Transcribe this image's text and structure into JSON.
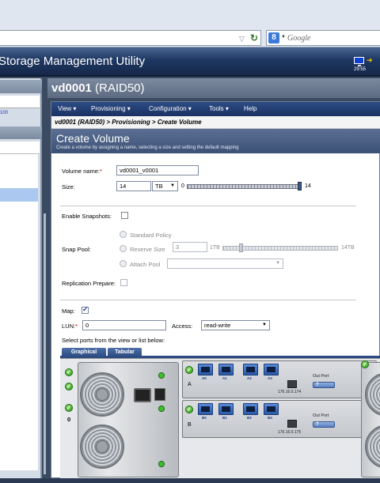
{
  "browser": {
    "search_placeholder": "Google",
    "search_engine_letter": "8"
  },
  "app": {
    "title": "Storage Management Utility",
    "clock": "29:55"
  },
  "left_panel": {
    "link_fragment": "100"
  },
  "header": {
    "volume_name": "vd0001",
    "raid_level": "(RAID50)"
  },
  "menu": [
    {
      "label": "View ▾"
    },
    {
      "label": "Provisioning ▾"
    },
    {
      "label": "Configuration ▾"
    },
    {
      "label": "Tools ▾"
    },
    {
      "label": "Help"
    }
  ],
  "breadcrumb": "vd0001 (RAID50) > Provisioning > Create Volume",
  "page": {
    "title": "Create Volume",
    "subtitle": "Create a volume by assigning a name, selecting a size and setting the default mapping"
  },
  "form": {
    "volume_name_label": "Volume name:",
    "required_mark": "*",
    "volume_name_value": "vd0001_v0001",
    "size_label": "Size:",
    "size_value": "14",
    "size_unit": "TB",
    "size_slider_min": "0",
    "size_slider_max": "14",
    "size_slider_level": 1.0,
    "enable_snapshots_label": "Enable Snapshots:",
    "enable_snapshots_checked": false,
    "snap_pool_label": "Snap Pool:",
    "standard_policy_label": "Standard Policy",
    "reserve_size_label": "Reserve Size",
    "reserve_size_value": "3",
    "reserve_slider_min": "1TB",
    "reserve_slider_max": "14TB",
    "attach_pool_label": "Attach Pool",
    "replication_prepare_label": "Replication Prepare:",
    "map_label": "Map:",
    "map_checked": true,
    "lun_label": "LUN:",
    "lun_value": "0",
    "access_label": "Access:",
    "access_value": "read-write",
    "ports_instruction": "Select ports from the view or list below:",
    "tabs": [
      {
        "label": "Graphical"
      },
      {
        "label": "Tabular"
      }
    ]
  },
  "enclosure": {
    "enclosure_number": "0",
    "controller_a": {
      "letter": "A",
      "ports": [
        "A0",
        "A1",
        "A2",
        "A3"
      ],
      "ip": "176.16.0.174",
      "out_port_label": "Out Port"
    },
    "controller_b": {
      "letter": "B",
      "ports": [
        "B0",
        "B1",
        "B2",
        "B3"
      ],
      "ip": "176.16.0.175",
      "out_port_label": "Out Port"
    }
  },
  "colors": {
    "accent": "#1e3862",
    "menu_bg": "#2d4d85",
    "status_ok": "#2f9a1a",
    "required": "#cc0000"
  }
}
